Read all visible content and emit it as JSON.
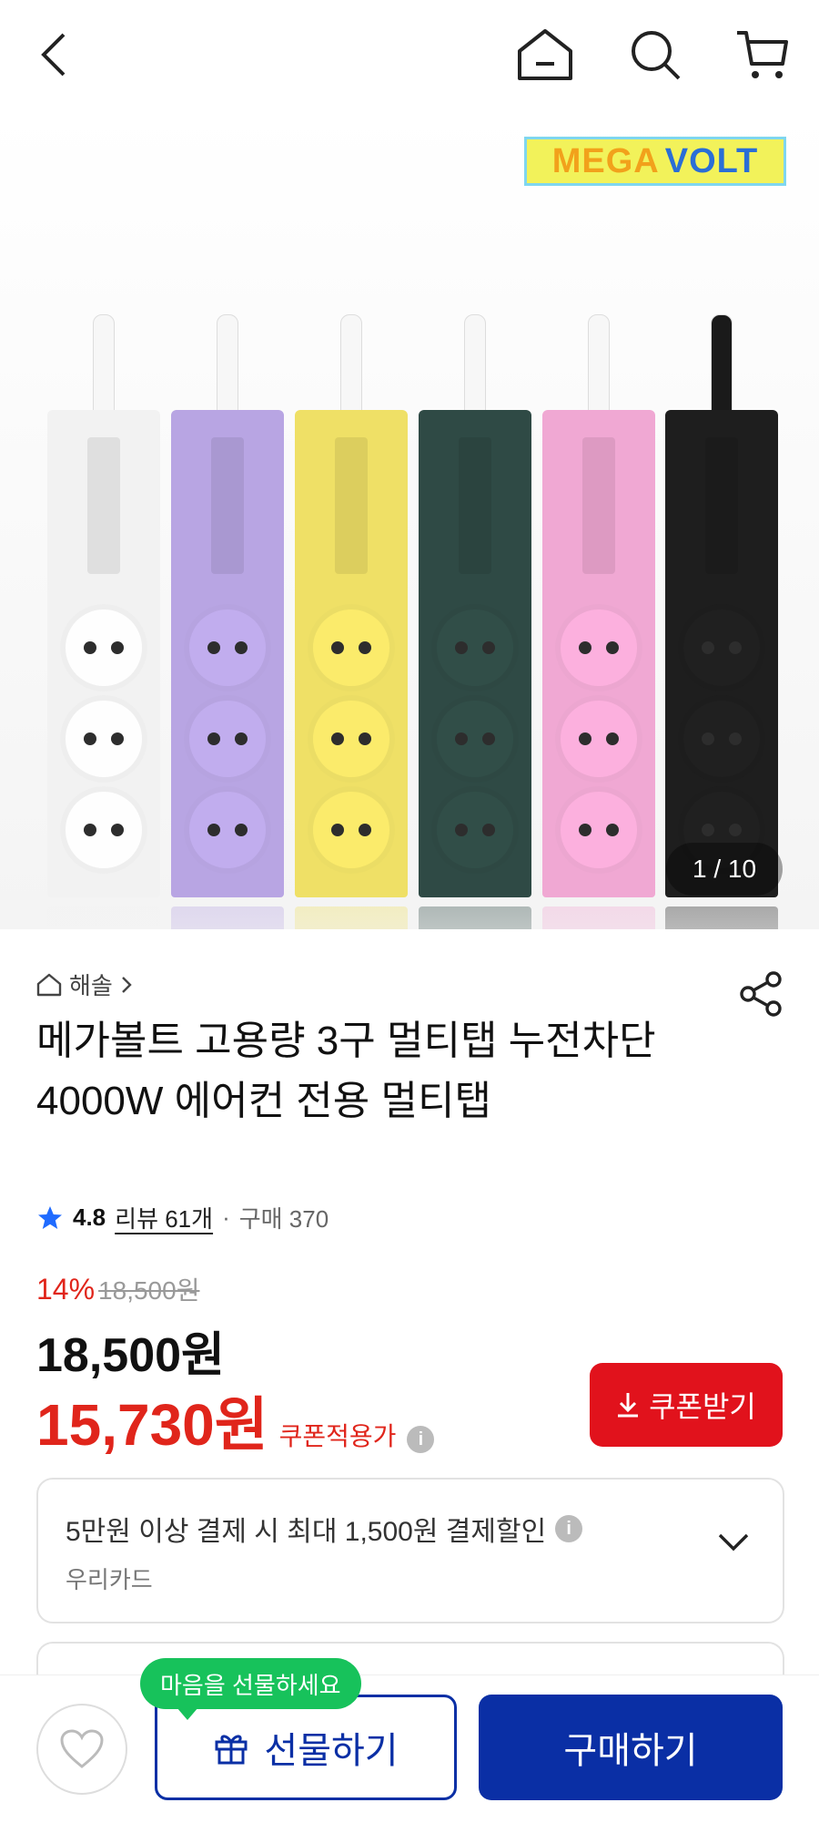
{
  "header": {
    "back_icon": "chevron-left-icon",
    "home_icon": "home-icon",
    "search_icon": "search-icon",
    "cart_icon": "cart-icon"
  },
  "hero": {
    "logo_part1": "MEGA",
    "logo_part2": "VOLT",
    "counter": "1 / 10",
    "strip_colors": [
      "#f2f2f2",
      "#b8a5e3",
      "#efe066",
      "#2f4a45",
      "#f0a8d3",
      "#1e1e1e"
    ]
  },
  "product": {
    "brand": "해솔",
    "title": "메가볼트 고용량 3구 멀티탭 누전차단 4000W 에어컨 전용 멀티탭",
    "rating": "4.8",
    "reviews": "리뷰 61개",
    "separator": "·",
    "purchases": "구매 370",
    "discount_rate": "14%",
    "original_price": "18,500원",
    "price": "18,500원",
    "coupon_price": "15,730원",
    "coupon_price_label": "쿠폰적용가",
    "coupon_button": "쿠폰받기"
  },
  "card_promo": {
    "text": "5만원 이상 결제 시 최대 1,500원 결제할인",
    "card_name": "우리카드"
  },
  "bottom": {
    "bubble": "마음을 선물하세요",
    "gift_button": "선물하기",
    "buy_button": "구매하기"
  },
  "colors": {
    "accent_red": "#e1121c",
    "primary_blue": "#0a2fa5",
    "bubble_green": "#17c25b"
  }
}
